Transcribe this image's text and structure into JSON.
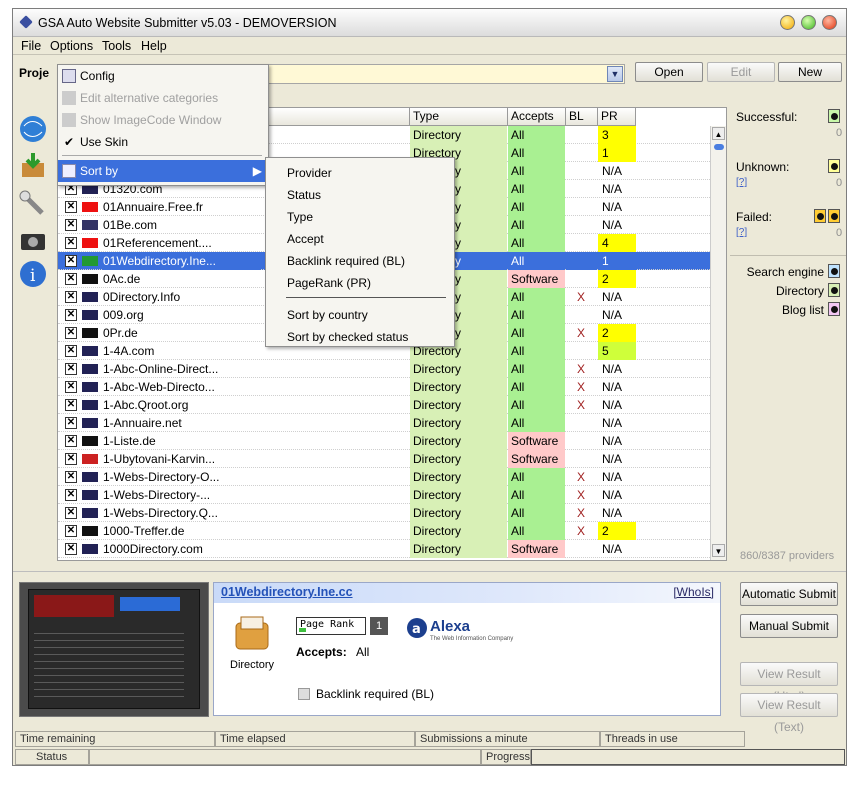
{
  "window": {
    "title": "GSA Auto Website Submitter v5.03 - DEMOVERSION"
  },
  "menubar": {
    "file": "File",
    "options": "Options",
    "tools": "Tools",
    "help": "Help"
  },
  "project": {
    "label": "Proje",
    "open": "Open",
    "edit": "Edit",
    "new": "New"
  },
  "grid": {
    "headers": {
      "type": "Type",
      "accepts": "Accepts",
      "bl": "BL",
      "pr": "PR"
    },
    "rows": [
      {
        "name": "",
        "type": "Directory",
        "accepts": "All",
        "bl": "",
        "pr": "3",
        "prc": "y"
      },
      {
        "name": "",
        "type": "Directory",
        "accepts": "All",
        "bl": "",
        "pr": "1",
        "prc": "y"
      },
      {
        "name": "",
        "type": "Directory",
        "accepts": "All",
        "bl": "",
        "pr": "N/A",
        "prc": ""
      },
      {
        "name": "01320.com",
        "type": "Directory",
        "accepts": "All",
        "bl": "",
        "pr": "N/A",
        "prc": ""
      },
      {
        "name": "01Annuaire.Free.fr",
        "type": "Directory",
        "accepts": "All",
        "bl": "",
        "pr": "N/A",
        "prc": ""
      },
      {
        "name": "01Be.com",
        "type": "Directory",
        "accepts": "All",
        "bl": "",
        "pr": "N/A",
        "prc": ""
      },
      {
        "name": "01Referencement....",
        "type": "Directory",
        "accepts": "All",
        "bl": "",
        "pr": "4",
        "prc": "y"
      },
      {
        "name": "01Webdirectory.Ine...",
        "type": "Directory",
        "accepts": "All",
        "bl": "",
        "pr": "1",
        "prc": "",
        "sel": true
      },
      {
        "name": "0Ac.de",
        "type": "Directory",
        "accepts": "Software",
        "bl": "",
        "pr": "2",
        "prc": "y"
      },
      {
        "name": "0Directory.Info",
        "type": "Directory",
        "accepts": "All",
        "bl": "X",
        "pr": "N/A",
        "prc": ""
      },
      {
        "name": "009.org",
        "type": "Directory",
        "accepts": "All",
        "bl": "",
        "pr": "N/A",
        "prc": ""
      },
      {
        "name": "0Pr.de",
        "type": "Directory",
        "accepts": "All",
        "bl": "X",
        "pr": "2",
        "prc": "y"
      },
      {
        "name": "1-4A.com",
        "type": "Directory",
        "accepts": "All",
        "bl": "",
        "pr": "5",
        "prc": "g"
      },
      {
        "name": "1-Abc-Online-Direct...",
        "type": "Directory",
        "accepts": "All",
        "bl": "X",
        "pr": "N/A",
        "prc": ""
      },
      {
        "name": "1-Abc-Web-Directo...",
        "type": "Directory",
        "accepts": "All",
        "bl": "X",
        "pr": "N/A",
        "prc": ""
      },
      {
        "name": "1-Abc.Qroot.org",
        "type": "Directory",
        "accepts": "All",
        "bl": "X",
        "pr": "N/A",
        "prc": ""
      },
      {
        "name": "1-Annuaire.net",
        "type": "Directory",
        "accepts": "All",
        "bl": "",
        "pr": "N/A",
        "prc": ""
      },
      {
        "name": "1-Liste.de",
        "type": "Directory",
        "accepts": "Software",
        "bl": "",
        "pr": "N/A",
        "prc": ""
      },
      {
        "name": "1-Ubytovani-Karvin...",
        "type": "Directory",
        "accepts": "Software",
        "bl": "",
        "pr": "N/A",
        "prc": ""
      },
      {
        "name": "1-Webs-Directory-O...",
        "type": "Directory",
        "accepts": "All",
        "bl": "X",
        "pr": "N/A",
        "prc": ""
      },
      {
        "name": "1-Webs-Directory-...",
        "type": "Directory",
        "accepts": "All",
        "bl": "X",
        "pr": "N/A",
        "prc": ""
      },
      {
        "name": "1-Webs-Directory.Q...",
        "type": "Directory",
        "accepts": "All",
        "bl": "X",
        "pr": "N/A",
        "prc": ""
      },
      {
        "name": "1000-Treffer.de",
        "type": "Directory",
        "accepts": "All",
        "bl": "X",
        "pr": "2",
        "prc": "y"
      },
      {
        "name": "1000Directory.com",
        "type": "Directory",
        "accepts": "Software",
        "bl": "",
        "pr": "N/A",
        "prc": ""
      }
    ]
  },
  "options_menu": {
    "config": "Config",
    "edit_alt": "Edit alternative categories",
    "show_image": "Show ImageCode Window",
    "use_skin": "Use Skin",
    "sort_by": "Sort by"
  },
  "sort_menu": [
    "Provider",
    "Status",
    "Type",
    "Accept",
    "Backlink required (BL)",
    "PageRank (PR)",
    "Sort by country",
    "Sort by checked status"
  ],
  "right_panel": {
    "successful": "Successful:",
    "successful_n": "0",
    "unknown": "Unknown:",
    "unknown_n": "0",
    "failed": "Failed:",
    "failed_n": "0",
    "q": "[?]",
    "search_engine": "Search engine",
    "directory": "Directory",
    "blog_list": "Blog list",
    "providers": "860/8387 providers"
  },
  "details": {
    "site": "01Webdirectory.Ine.cc",
    "whois": "[WhoIs]",
    "page_rank_label": "Page Rank",
    "page_rank_value": "1",
    "accepts_label": "Accepts:",
    "accepts_value": "All",
    "type_label": "Directory",
    "backlink": "Backlink required (BL)",
    "alexa": "Alexa",
    "alexa_sub": "The Web Information Company"
  },
  "actions": {
    "auto": "Automatic Submit",
    "manual": "Manual Submit",
    "view_html": "View Result (Html)",
    "view_text": "View Result (Text)"
  },
  "statusbar": {
    "time_remaining": "Time remaining",
    "time_elapsed": "Time elapsed",
    "submissions": "Submissions a minute",
    "threads": "Threads in use",
    "status": "Status",
    "progress": "Progress"
  }
}
